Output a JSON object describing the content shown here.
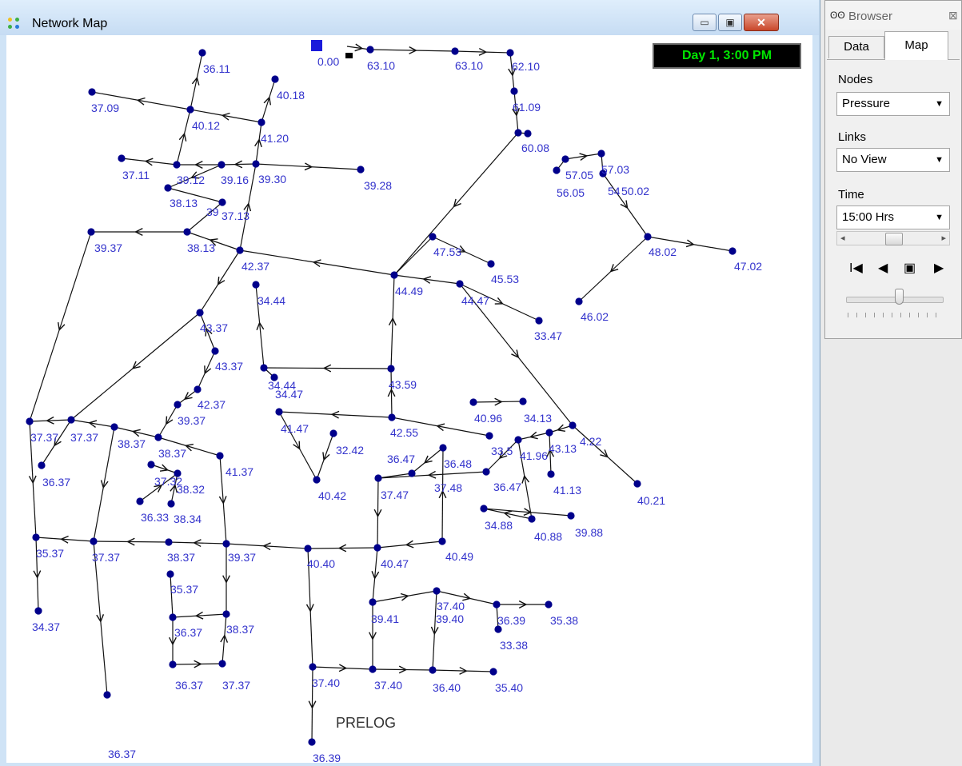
{
  "window": {
    "title": "Network Map",
    "clock": "Day 1, 3:00 PM",
    "caption": "PRELOG",
    "minimize_glyph": "▭",
    "maximize_glyph": "▣",
    "close_glyph": "✕"
  },
  "browser": {
    "title": "Browser",
    "icon": "binoculars-icon",
    "icon_glyph": "ʘʘ",
    "close_glyph": "⊠",
    "tabs": [
      "Data",
      "Map"
    ],
    "active_tab": "Map",
    "nodes_label": "Nodes",
    "nodes_value": "Pressure",
    "links_label": "Links",
    "links_value": "No View",
    "time_label": "Time",
    "time_value": "15:00 Hrs",
    "time_fraction": 0.5,
    "controls": [
      "I◀",
      "◀",
      "▣",
      "▶"
    ],
    "dropdown_glyph": "▼",
    "scroll_left_glyph": "◂",
    "scroll_right_glyph": "▸",
    "animation_speed_fraction": 0.55
  },
  "colors": {
    "node": "#00008b",
    "label": "#3333cc",
    "link": "#111111",
    "clock_text": "#00e600",
    "reservoir": "#1a1adb"
  },
  "pressure_labels": [
    "36.11",
    "37.09",
    "40.18",
    "40.12",
    "41.20",
    "37.11",
    "39.12",
    "39.16",
    "39.30",
    "39.28",
    "38.13",
    "39",
    "37.13",
    "0.00",
    "63.10",
    "63.10",
    "62.10",
    "61.09",
    "60.08",
    "57.05",
    "57.03",
    "56.05",
    "54",
    "50.02",
    "48.02",
    "47.02",
    "46.02",
    "39.37",
    "38.13",
    "42.37",
    "47.53",
    "45.53",
    "44.49",
    "44.47",
    "33.47",
    "34.44",
    "43.37",
    "43.37",
    "43.59",
    "34.44",
    "34.47",
    "42.37",
    "39.37",
    "37.37",
    "37.37",
    "38.37",
    "38.37",
    "41.37",
    "41.47",
    "42.55",
    "32.42",
    "36.47",
    "36.48",
    "37.48",
    "37.47",
    "40.96",
    "34.13",
    "33.5",
    "41.96",
    "43.13",
    "4.22",
    "36.47",
    "41.13",
    "40.21",
    "36.37",
    "37.32",
    "38.32",
    "36.33",
    "38.34",
    "34.88",
    "40.88",
    "39.88",
    "40.42",
    "35.37",
    "37.37",
    "38.37",
    "39.37",
    "40.40",
    "40.47",
    "40.49",
    "35.37",
    "34.37",
    "36.37",
    "38.37",
    "37.40",
    "39.41",
    "39.40",
    "36.39",
    "35.38",
    "33.38",
    "36.37",
    "37.37",
    "37.40",
    "37.40",
    "36.40",
    "35.40",
    "36.37",
    "36.39"
  ]
}
